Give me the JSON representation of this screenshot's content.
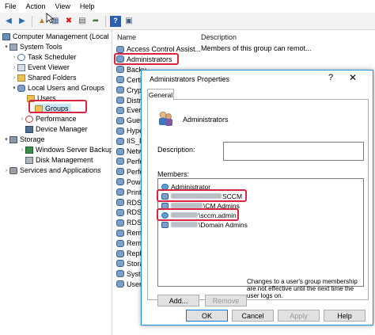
{
  "menu": [
    "File",
    "Action",
    "View",
    "Help"
  ],
  "tree": {
    "root": "Computer Management (Local",
    "system_tools": "System Tools",
    "task_scheduler": "Task Scheduler",
    "event_viewer": "Event Viewer",
    "shared_folders": "Shared Folders",
    "local_users_groups": "Local Users and Groups",
    "users": "Users",
    "groups": "Groups",
    "performance": "Performance",
    "device_manager": "Device Manager",
    "storage": "Storage",
    "windows_server_backup": "Windows Server Backup",
    "disk_management": "Disk Management",
    "services_apps": "Services and Applications"
  },
  "list": {
    "col_name": "Name",
    "col_description": "Description",
    "rows": [
      {
        "name": "Access Control Assist...",
        "description": "Members of this group can remot..."
      },
      {
        "name": "Administrators",
        "description": ""
      },
      {
        "name": "Backu",
        "description": ""
      },
      {
        "name": "Certi",
        "description": ""
      },
      {
        "name": "Cryp",
        "description": ""
      },
      {
        "name": "Distr",
        "description": ""
      },
      {
        "name": "Even",
        "description": ""
      },
      {
        "name": "Gues",
        "description": ""
      },
      {
        "name": "Hype",
        "description": ""
      },
      {
        "name": "IIS_II",
        "description": ""
      },
      {
        "name": "Netw",
        "description": ""
      },
      {
        "name": "Perfo",
        "description": ""
      },
      {
        "name": "Perfo",
        "description": ""
      },
      {
        "name": "Powe",
        "description": ""
      },
      {
        "name": "Print",
        "description": ""
      },
      {
        "name": "RDS",
        "description": ""
      },
      {
        "name": "RDS",
        "description": ""
      },
      {
        "name": "RDS",
        "description": ""
      },
      {
        "name": "Rem",
        "description": ""
      },
      {
        "name": "Rem",
        "description": ""
      },
      {
        "name": "Repli",
        "description": ""
      },
      {
        "name": "Stora",
        "description": ""
      },
      {
        "name": "Syste",
        "description": ""
      },
      {
        "name": "Users",
        "description": ""
      }
    ]
  },
  "dialog": {
    "title": "Administrators Properties",
    "help": "?",
    "close": "✕",
    "tab_general": "General",
    "group_name": "Administrators",
    "description_label": "Description:",
    "description_value": "",
    "members_label": "Members:",
    "members": [
      {
        "suffix": "Administrator"
      },
      {
        "suffix": "SCCM"
      },
      {
        "suffix": "\\CM Admins"
      },
      {
        "suffix": "\\sccm.admin"
      },
      {
        "suffix": "\\Domain Admins"
      }
    ],
    "add_button": "Add...",
    "remove_button": "Remove",
    "note": "Changes to a user's group membership are not effective until the next time the user logs on.",
    "ok_button": "OK",
    "cancel_button": "Cancel",
    "apply_button": "Apply",
    "help_button": "Help"
  },
  "icons": {
    "toolbar": [
      "back-icon",
      "forward-icon",
      "up-folder-icon",
      "show-tree-icon",
      "delete-icon",
      "properties-icon",
      "export-icon",
      "help-icon",
      "console-icon"
    ]
  },
  "colors": {
    "highlight": "#d7263d",
    "dialog_border": "#1e90e0",
    "primary_button_border": "#0078d7"
  }
}
